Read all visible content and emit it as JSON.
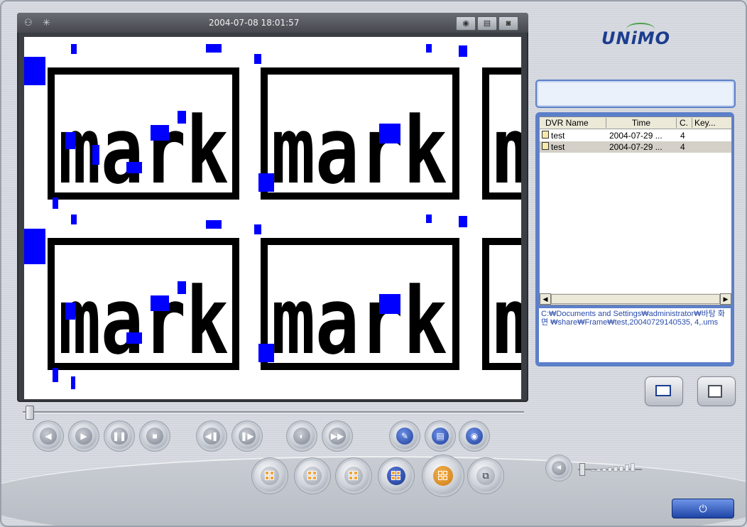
{
  "window": {
    "brand": "UNiMO"
  },
  "video": {
    "timestamp": "2004-07-08 18:01:57",
    "watermark_text": "mark",
    "header_icons": [
      "network-icon",
      "status-icon"
    ],
    "header_buttons": [
      "snapshot-icon",
      "print-icon",
      "capture-icon"
    ]
  },
  "playback": {
    "seek_position": 0.0,
    "buttons": [
      "rewind-icon",
      "play-icon",
      "pause-icon",
      "stop-icon",
      "step-back-icon",
      "step-forward-icon",
      "slow-icon",
      "fast-icon",
      "save-icon",
      "print-icon",
      "snapshot-icon"
    ]
  },
  "layouts": {
    "buttons": [
      "layout-1-icon",
      "layout-4-icon",
      "layout-9-icon",
      "layout-16-icon",
      "layout-quad-icon",
      "layout-full-icon"
    ]
  },
  "list": {
    "columns": [
      "DVR Name",
      "Time",
      "C.",
      "Key..."
    ],
    "rows": [
      {
        "name": "test",
        "time": "2004-07-29 ...",
        "c": "4",
        "key": ""
      },
      {
        "name": "test",
        "time": "2004-07-29 ...",
        "c": "4",
        "key": ""
      }
    ],
    "selected_row": 1
  },
  "path_text": "C:\\Documents and Settings\\administrator\\바탕 화면\\share\\Frame\\test,20040729140535,4,.ums",
  "path_display": "C:₩Documents and Settings₩administrator₩바탕 화면 ₩share₩Frame₩test,20040729140535, 4,.ums",
  "volume": {
    "level": 0.0
  },
  "colors": {
    "accent": "#1c3d8f",
    "panel_border": "#5c7fc9",
    "mark_blue": "#0000ff"
  }
}
